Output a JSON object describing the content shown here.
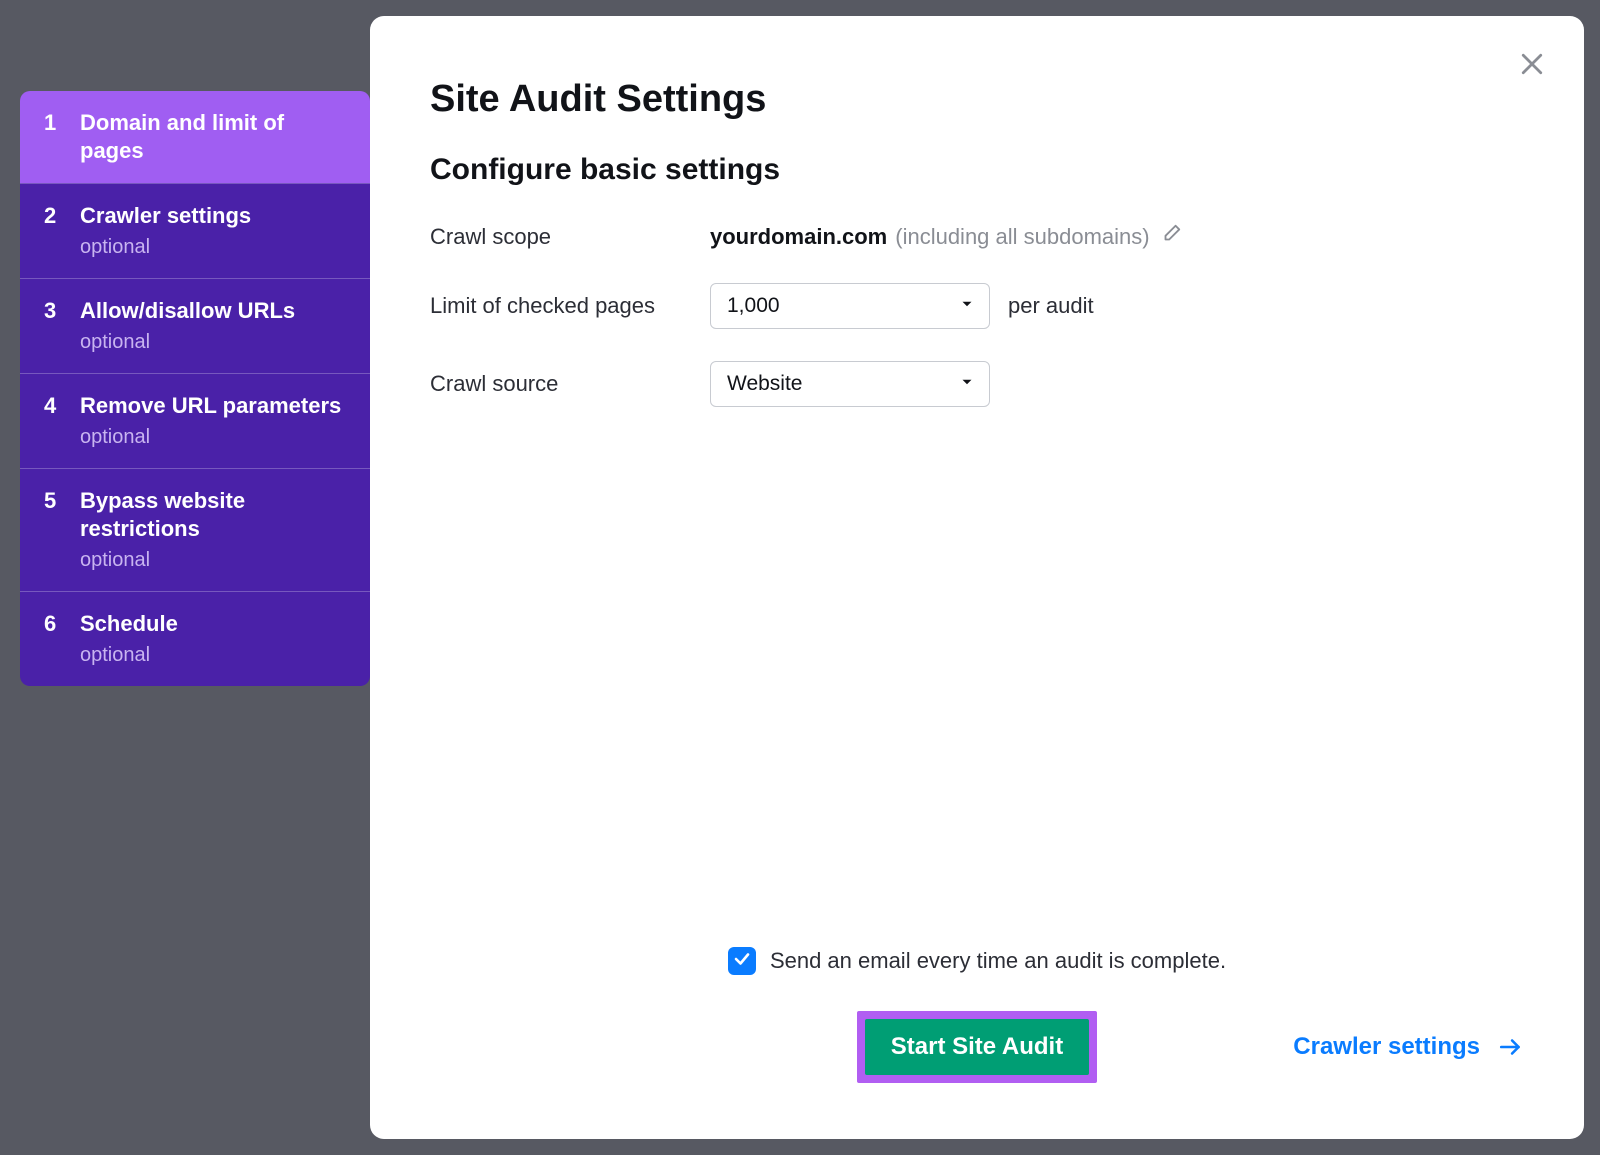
{
  "sidebar": {
    "steps": [
      {
        "num": "1",
        "title": "Domain and limit of pages",
        "optional": ""
      },
      {
        "num": "2",
        "title": "Crawler settings",
        "optional": "optional"
      },
      {
        "num": "3",
        "title": "Allow/disallow URLs",
        "optional": "optional"
      },
      {
        "num": "4",
        "title": "Remove URL parameters",
        "optional": "optional"
      },
      {
        "num": "5",
        "title": "Bypass website restrictions",
        "optional": "optional"
      },
      {
        "num": "6",
        "title": "Schedule",
        "optional": "optional"
      }
    ]
  },
  "panel": {
    "title": "Site Audit Settings",
    "subtitle": "Configure basic settings",
    "scope_label": "Crawl scope",
    "scope_domain": "yourdomain.com",
    "scope_note": "(including all subdomains)",
    "limit_label": "Limit of checked pages",
    "limit_value": "1,000",
    "limit_suffix": "per audit",
    "source_label": "Crawl source",
    "source_value": "Website"
  },
  "footer": {
    "email_label": "Send an email every time an audit is complete.",
    "email_checked": true,
    "start_label": "Start Site Audit",
    "next_label": "Crawler settings"
  }
}
